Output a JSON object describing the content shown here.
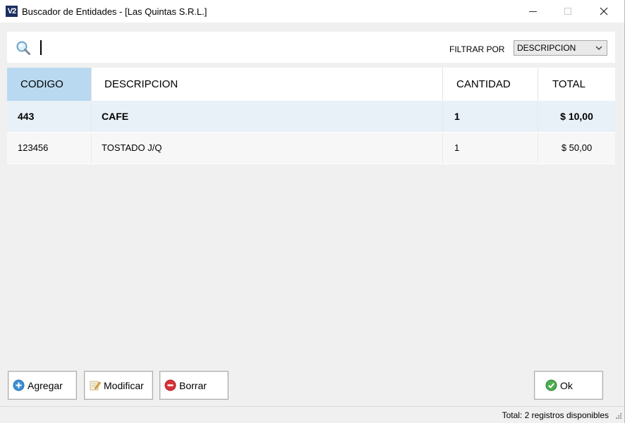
{
  "window": {
    "title": "Buscador de Entidades - [Las Quintas S.R.L.]",
    "logo_text": "V2"
  },
  "search": {
    "value": "",
    "filter_label": "FILTRAR POR",
    "filter_selected": "DESCRIPCION"
  },
  "table": {
    "headers": [
      "CODIGO",
      "DESCRIPCION",
      "CANTIDAD",
      "TOTAL"
    ],
    "rows": [
      {
        "codigo": "443",
        "descripcion": "CAFE",
        "cantidad": "1",
        "total": "$ 10,00"
      },
      {
        "codigo": "123456",
        "descripcion": "TOSTADO J/Q",
        "cantidad": "1",
        "total": "$ 50,00"
      }
    ]
  },
  "buttons": {
    "add": "Agregar",
    "modify": "Modificar",
    "delete": "Borrar",
    "ok": "Ok"
  },
  "status": {
    "text": "Total: 2 registros disponibles"
  },
  "colors": {
    "header_active": "#b9d9f1",
    "selected_row": "#e8f0f8",
    "app_logo": "#1c2f62"
  }
}
